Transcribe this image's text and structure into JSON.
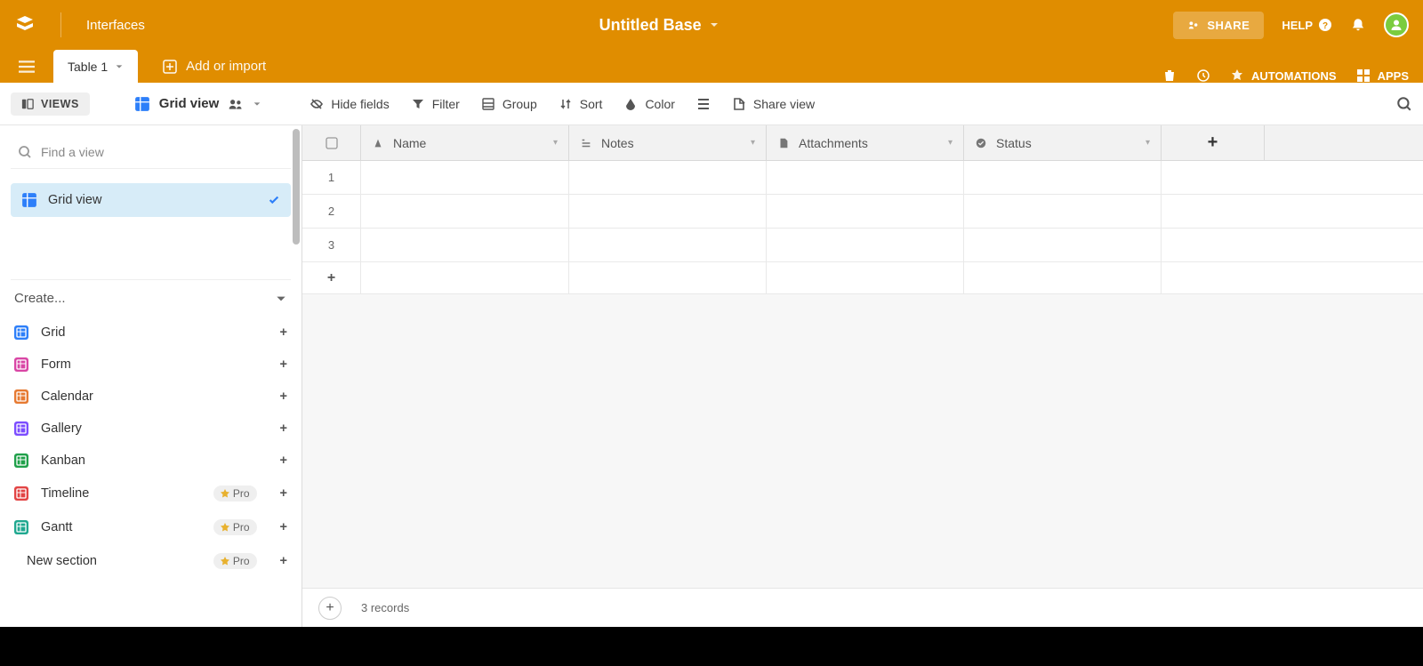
{
  "topbar": {
    "interfaces": "Interfaces",
    "base_title": "Untitled Base",
    "share": "SHARE",
    "help": "HELP"
  },
  "tabsbar": {
    "tab1": "Table 1",
    "add_import": "Add or import",
    "automations": "AUTOMATIONS",
    "apps": "APPS"
  },
  "toolbar": {
    "views": "VIEWS",
    "view_name": "Grid view",
    "hide_fields": "Hide fields",
    "filter": "Filter",
    "group": "Group",
    "sort": "Sort",
    "color": "Color",
    "share_view": "Share view"
  },
  "sidebar": {
    "find_placeholder": "Find a view",
    "views": [
      {
        "label": "Grid view",
        "active": true
      }
    ],
    "create_label": "Create...",
    "create_items": [
      {
        "label": "Grid",
        "color": "#2d7ff9",
        "pro": false
      },
      {
        "label": "Form",
        "color": "#d946a5",
        "pro": false
      },
      {
        "label": "Calendar",
        "color": "#e67a32",
        "pro": false
      },
      {
        "label": "Gallery",
        "color": "#7c4dff",
        "pro": false
      },
      {
        "label": "Kanban",
        "color": "#20a04a",
        "pro": false
      },
      {
        "label": "Timeline",
        "color": "#e24444",
        "pro": true
      },
      {
        "label": "Gantt",
        "color": "#20a890",
        "pro": true
      },
      {
        "label": "New section",
        "color": "",
        "pro": true,
        "no_icon": true
      }
    ],
    "pro_label": "Pro"
  },
  "grid": {
    "columns": [
      "Name",
      "Notes",
      "Attachments",
      "Status"
    ],
    "rows": [
      1,
      2,
      3
    ],
    "footer_count": "3 records"
  }
}
